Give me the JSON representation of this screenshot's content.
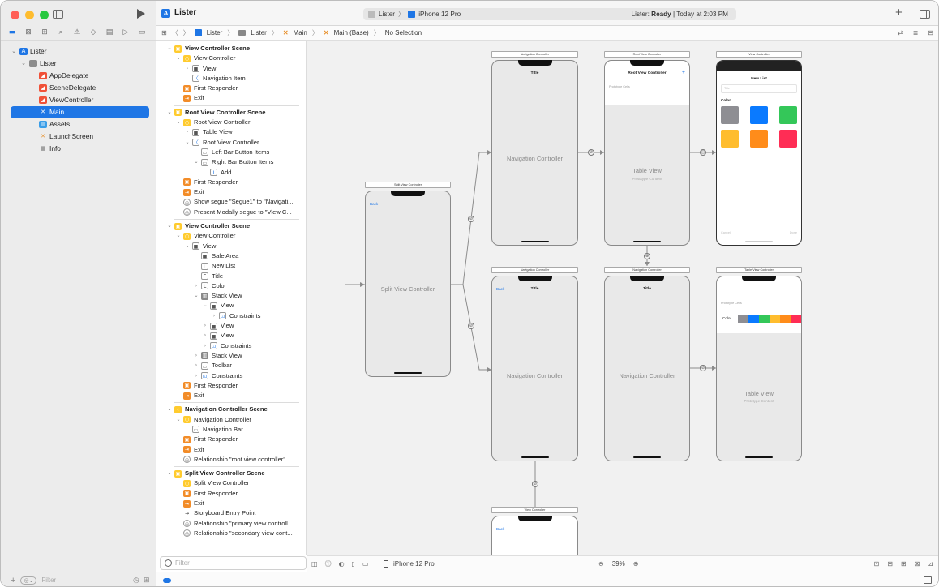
{
  "window": {
    "app_title": "Lister"
  },
  "activity": {
    "scheme": "Lister",
    "device": "iPhone 12 Pro",
    "status_prefix": "Lister:",
    "status_state": "Ready",
    "status_time": "| Today at 2:03 PM"
  },
  "navigator": {
    "items": [
      {
        "label": "Lister",
        "icon": "xcode-project-icon",
        "indent": 0
      },
      {
        "label": "Lister",
        "icon": "folder-icon",
        "indent": 1
      },
      {
        "label": "AppDelegate",
        "icon": "swift-file-icon",
        "indent": 2
      },
      {
        "label": "SceneDelegate",
        "icon": "swift-file-icon",
        "indent": 2
      },
      {
        "label": "ViewController",
        "icon": "swift-file-icon",
        "indent": 2
      },
      {
        "label": "Main",
        "icon": "storyboard-icon",
        "indent": 2,
        "selected": true
      },
      {
        "label": "Assets",
        "icon": "asset-catalog-icon",
        "indent": 2
      },
      {
        "label": "LaunchScreen",
        "icon": "storyboard-icon",
        "indent": 2
      },
      {
        "label": "Info",
        "icon": "plist-icon",
        "indent": 2
      }
    ],
    "filter_placeholder": "Filter"
  },
  "jumpbar": {
    "crumbs": [
      "Lister",
      "Lister",
      "Main",
      "Main (Base)",
      "No Selection"
    ]
  },
  "outline": {
    "filter_placeholder": "Filter",
    "rows": [
      {
        "t": "View Controller Scene",
        "d": 0,
        "scene": true,
        "disc": "v"
      },
      {
        "t": "View Controller",
        "d": 1,
        "disc": "v",
        "ic": "vc"
      },
      {
        "t": "View",
        "d": 2,
        "disc": ">",
        "ic": "view"
      },
      {
        "t": "Navigation Item",
        "d": 2,
        "ic": "navitem"
      },
      {
        "t": "First Responder",
        "d": 1,
        "ic": "fr"
      },
      {
        "t": "Exit",
        "d": 1,
        "ic": "exit"
      },
      {
        "sep": true
      },
      {
        "t": "Root View Controller Scene",
        "d": 0,
        "scene": true,
        "disc": "v"
      },
      {
        "t": "Root View Controller",
        "d": 1,
        "disc": "v",
        "ic": "vc"
      },
      {
        "t": "Table View",
        "d": 2,
        "disc": ">",
        "ic": "view"
      },
      {
        "t": "Root View Controller",
        "d": 2,
        "disc": "v",
        "ic": "navitem"
      },
      {
        "t": "Left Bar Button Items",
        "d": 3,
        "ic": "doc"
      },
      {
        "t": "Right Bar Button Items",
        "d": 3,
        "disc": "v",
        "ic": "doc"
      },
      {
        "t": "Add",
        "d": 4,
        "ic": "barbtn"
      },
      {
        "t": "First Responder",
        "d": 1,
        "ic": "fr"
      },
      {
        "t": "Exit",
        "d": 1,
        "ic": "exit"
      },
      {
        "t": "Show segue \"Segue1\" to \"Navigati...",
        "d": 1,
        "ic": "segue"
      },
      {
        "t": "Present Modally segue to \"View C...",
        "d": 1,
        "ic": "segue"
      },
      {
        "sep": true
      },
      {
        "t": "View Controller Scene",
        "d": 0,
        "scene": true,
        "disc": "v"
      },
      {
        "t": "View Controller",
        "d": 1,
        "disc": "v",
        "ic": "vc"
      },
      {
        "t": "View",
        "d": 2,
        "disc": "v",
        "ic": "view"
      },
      {
        "t": "Safe Area",
        "d": 3,
        "ic": "view"
      },
      {
        "t": "New List",
        "d": 3,
        "ic": "label"
      },
      {
        "t": "Title",
        "d": 3,
        "ic": "field"
      },
      {
        "t": "Color",
        "d": 3,
        "disc": ">",
        "ic": "label"
      },
      {
        "t": "Stack View",
        "d": 3,
        "disc": "v",
        "ic": "stack"
      },
      {
        "t": "View",
        "d": 4,
        "disc": "v",
        "ic": "view"
      },
      {
        "t": "Constraints",
        "d": 5,
        "disc": ">",
        "ic": "constraint"
      },
      {
        "t": "View",
        "d": 4,
        "disc": ">",
        "ic": "view"
      },
      {
        "t": "View",
        "d": 4,
        "disc": ">",
        "ic": "view"
      },
      {
        "t": "Constraints",
        "d": 4,
        "disc": ">",
        "ic": "constraint"
      },
      {
        "t": "Stack View",
        "d": 3,
        "disc": ">",
        "ic": "stack"
      },
      {
        "t": "Toolbar",
        "d": 3,
        "disc": ">",
        "ic": "doc"
      },
      {
        "t": "Constraints",
        "d": 3,
        "disc": ">",
        "ic": "constraint"
      },
      {
        "t": "First Responder",
        "d": 1,
        "ic": "fr"
      },
      {
        "t": "Exit",
        "d": 1,
        "ic": "exit"
      },
      {
        "sep": true
      },
      {
        "t": "Navigation Controller Scene",
        "d": 0,
        "scene": true,
        "disc": "v"
      },
      {
        "t": "Navigation Controller",
        "d": 1,
        "disc": "v",
        "ic": "vc"
      },
      {
        "t": "Navigation Bar",
        "d": 2,
        "ic": "doc"
      },
      {
        "t": "First Responder",
        "d": 1,
        "ic": "fr"
      },
      {
        "t": "Exit",
        "d": 1,
        "ic": "exit"
      },
      {
        "t": "Relationship \"root view controller\"...",
        "d": 1,
        "ic": "segue"
      },
      {
        "sep": true
      },
      {
        "t": "Split View Controller Scene",
        "d": 0,
        "scene": true,
        "disc": "v"
      },
      {
        "t": "Split View Controller",
        "d": 1,
        "ic": "vc"
      },
      {
        "t": "First Responder",
        "d": 1,
        "ic": "fr"
      },
      {
        "t": "Exit",
        "d": 1,
        "ic": "exit"
      },
      {
        "t": "Storyboard Entry Point",
        "d": 1,
        "ic": "arrow"
      },
      {
        "t": "Relationship \"primary view controll...",
        "d": 1,
        "ic": "segue"
      },
      {
        "t": "Relationship \"secondary view cont...",
        "d": 1,
        "ic": "segue"
      }
    ]
  },
  "canvas": {
    "split": {
      "dock": "Split View Controller",
      "back": "Back",
      "label": "Split View Controller"
    },
    "nav1": {
      "dock": "Navigation Controller",
      "title": "Title",
      "label": "Navigation Controller"
    },
    "root": {
      "dock": "Root View Controller",
      "title": "Root View Controller",
      "add": "+",
      "cells": "Prototype Cells",
      "label": "Table View",
      "sub": "Prototype Content"
    },
    "vc_top": {
      "dock": "View Controller",
      "title": "New List",
      "field": "Title",
      "color": "Color",
      "cancel": "Cancel",
      "done": "Done",
      "swatches": [
        "#8e8e93",
        "#0a7aff",
        "#34c759",
        "#ffbd2e",
        "#ff8c1a",
        "#ff2d55"
      ]
    },
    "nav2": {
      "dock": "Navigation Controller",
      "back": "Back",
      "title": "Title",
      "label": "Navigation Controller"
    },
    "nav3": {
      "dock": "Navigation Controller",
      "title": "Title",
      "label": "Navigation Controller"
    },
    "tablevc": {
      "dock": "Table View Controller",
      "cells": "Prototype Cells",
      "color": "Color",
      "label": "Table View",
      "sub": "Prototype Content",
      "bar": [
        "#8e8e93",
        "#0a7aff",
        "#34c759",
        "#ffbd2e",
        "#ff8c1a",
        "#ff2d55"
      ]
    },
    "vc_bottom": {
      "dock": "View Controller",
      "back": "Back"
    }
  },
  "canvas_bar": {
    "device": "iPhone 12 Pro",
    "zoom": "39%"
  }
}
